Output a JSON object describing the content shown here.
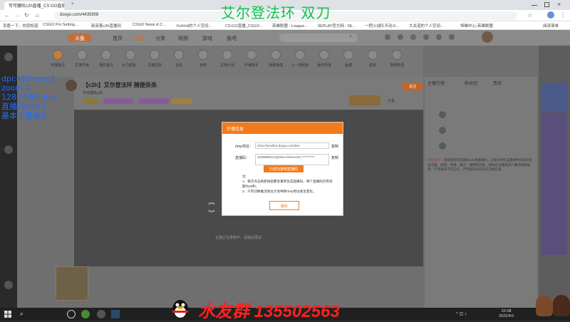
{
  "browser": {
    "tabs": [
      {
        "label": "可可磨叽c2h直播_CS:GO直播_斗..."
      },
      {
        "label": "+"
      }
    ],
    "url": "douyu.com/4435908",
    "bookmarks": [
      "百度一下，你就知道",
      "CSGO Pro Setting...",
      "新亮客c2h直播间",
      "CSGO News & C...",
      "KotVoli的个人空间...",
      "CS:GO直播_CSGO...",
      "英雄联盟 - League...",
      "5EPLAY官方网 - 5E...",
      "一把火战队不动火...",
      "大关道的个人空间...",
      "恒峰中心-英雄联盟",
      "阅读清单"
    ]
  },
  "site": {
    "logo": "斗鱼",
    "nav": [
      "首页",
      "直播",
      "分类",
      "视频",
      "游戏",
      "鱼吧"
    ]
  },
  "categories": [
    "开播指引",
    "主播节目",
    "我的鱼丸",
    "大力超级...",
    "主播任务",
    "活动",
    "鱼吧",
    "主播计划",
    "开播助手",
    "弹幕管理",
    "上一场回放",
    "鱼吧周报",
    "鱼塘",
    "收徒",
    "视频管理",
    "公会",
    "更多",
    "开播设置",
    "主播攻略"
  ],
  "room": {
    "title": "【c2h】艾尔登法环 随便杀杀",
    "streamer": "可可磨叽c2h",
    "category": "艾尔登法环",
    "tabs": [
      "分享",
      "关注"
    ],
    "video_status": "主播正在录制中，请稍后再试"
  },
  "modal": {
    "title": "开播信息",
    "rtmp_label": "rtmp地址：",
    "rtmp_value": "rtmp://sendtc3.douyu.com/live",
    "key_label": "直播码：",
    "key_value": "4435908rxxxQZdxo?wsSecret=**********",
    "copy_label": "复制",
    "toast": "已成功复制直播码",
    "notes": [
      "注：",
      "1、每次点击刷新按钮都会重新生成直播码，每个直播码仅有效期为30秒，",
      "2、只有切换推流地址才会导致rtmp地址发生变化。"
    ],
    "confirm": "确定"
  },
  "chat": {
    "tabs": [
      "主播打榜",
      "粉丝团",
      "贵宾"
    ],
    "notice_label": "系统提示：",
    "notice": "欢迎来到可可磨叽c2h的直播间。斗鱼坚持打击直播中的任何违法违规、低俗、色情、暴力、赌博等内容，请各位主播及用户遵守相关规定，严禁发表不实言论，严禁发布任何违法违规信息。"
  },
  "overlay": {
    "stream_title": "艾尔登法环 双刀",
    "stats": [
      "dpi:400 sen:3",
      "zoom:1",
      "1280 960 stret",
      "直播间6分门",
      "基本了摄像头"
    ],
    "qq_group": "水友群 135502563"
  },
  "taskbar": {
    "time": "22:08",
    "date": "2022/4/1"
  },
  "colors": {
    "brand": "#f37b1d",
    "title_green": "#12c24a",
    "stats_blue": "#1f6cff",
    "qq_red": "#ff2020"
  }
}
